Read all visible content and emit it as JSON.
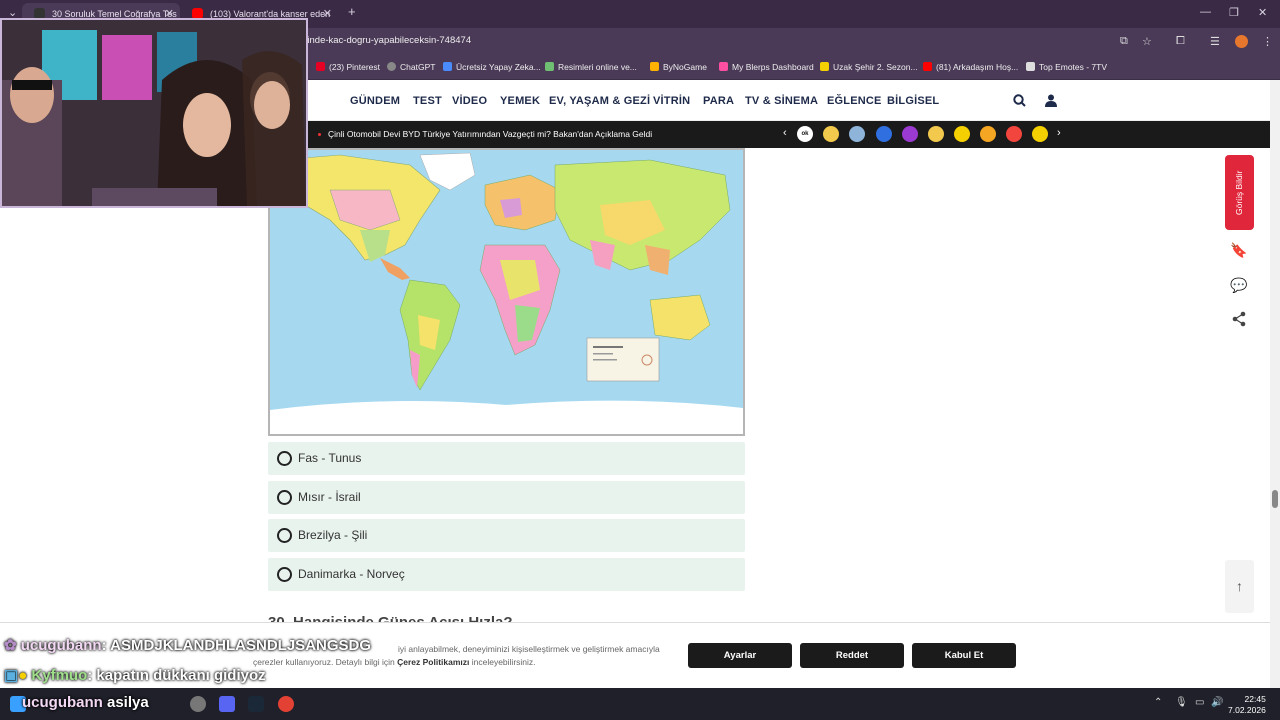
{
  "browser": {
    "tabs": [
      {
        "title": "30 Soruluk Temel Coğrafya Tes",
        "active": true,
        "favicon_color": "#333333"
      },
      {
        "title": "(103) Valorant'da kanser eden",
        "active": false,
        "favicon_color": "#ff0000"
      }
    ],
    "new_tab_symbol": "+",
    "url": "stinde-kac-dogru-yapabileceksin-748474",
    "bookmarks": [
      {
        "label": "(23) Pinterest",
        "icon": "pinterest-icon",
        "color": "#e60023"
      },
      {
        "label": "ChatGPT",
        "icon": "chatgpt-icon",
        "color": "#888888"
      },
      {
        "label": "Ücretsiz Yapay Zeka...",
        "icon": "gem-icon",
        "color": "#4a8cff"
      },
      {
        "label": "Resimleri online ve...",
        "icon": "rp-icon",
        "color": "#6fbf73"
      },
      {
        "label": "ByNoGame",
        "icon": "bynogame-icon",
        "color": "#ffb300"
      },
      {
        "label": "My Blerps Dashboard",
        "icon": "blerp-icon",
        "color": "#ff4fa3"
      },
      {
        "label": "Uzak Şehir 2. Sezon...",
        "icon": "tv-icon",
        "color": "#f5d000"
      },
      {
        "label": "(81) Arkadaşım Hoş...",
        "icon": "youtube-icon",
        "color": "#ff0000"
      },
      {
        "label": "Top Emotes - 7TV",
        "icon": "7tv-icon",
        "color": "#dddddd"
      }
    ]
  },
  "site": {
    "nav": [
      "GÜNDEM",
      "TEST",
      "VİDEO",
      "YEMEK",
      "EV, YAŞAM & GEZİ",
      "VİTRİN",
      "PARA",
      "TV & SİNEMA",
      "EĞLENCE",
      "BİLGİSEL"
    ],
    "ticker_headline": "Çinli Otomobil Devi BYD Türkiye Yatırımından Vazgeçti mi? Bakan'dan Açıklama Geldi",
    "ticker_chips": [
      {
        "label": "ok",
        "color": "#ffffff"
      },
      {
        "label": "",
        "color": "#f2c94c"
      },
      {
        "label": "",
        "color": "#8fb4d9"
      },
      {
        "label": "",
        "color": "#2f6fe0"
      },
      {
        "label": "",
        "color": "#9b3ad1"
      },
      {
        "label": "",
        "color": "#f2c94c"
      },
      {
        "label": "",
        "color": "#f5d000"
      },
      {
        "label": "",
        "color": "#f5a623"
      },
      {
        "label": "",
        "color": "#f2453d"
      },
      {
        "label": "",
        "color": "#f5d000"
      }
    ],
    "feedback_label": "Görüş Bildir"
  },
  "quiz": {
    "map_alt": "world political map",
    "options": [
      "Fas - Tunus",
      "Mısır - İsrail",
      "Brezilya - Şili",
      "Danimarka - Norveç"
    ],
    "next_question_partial": "30. Hangisinde Güneş Açısı Hızla?"
  },
  "cookie": {
    "text_line1": "iyi anlayabilmek, deneyiminizi kişiselleştirmek ve geliştirmek amacıyla",
    "text_line2_pre": "çerezler kullanıyoruz. Detaylı bilgi için ",
    "text_link": "Çerez Politikamızı",
    "text_line2_post": " inceleyebilirsiniz.",
    "buttons": [
      "Ayarlar",
      "Reddet",
      "Kabul Et"
    ]
  },
  "stream": {
    "chat": [
      {
        "user": "ucugubann",
        "message": ": ASMDJKLANDHLASNDLJSANGSDG"
      },
      {
        "user": "Kyfmuo",
        "message": ": kapatın dükkanı gidiyoz"
      }
    ],
    "streamer_name": "ucugubann",
    "streamer_name2": "asilya"
  },
  "taskbar": {
    "time": "22:45",
    "date": "7.02.2026"
  }
}
